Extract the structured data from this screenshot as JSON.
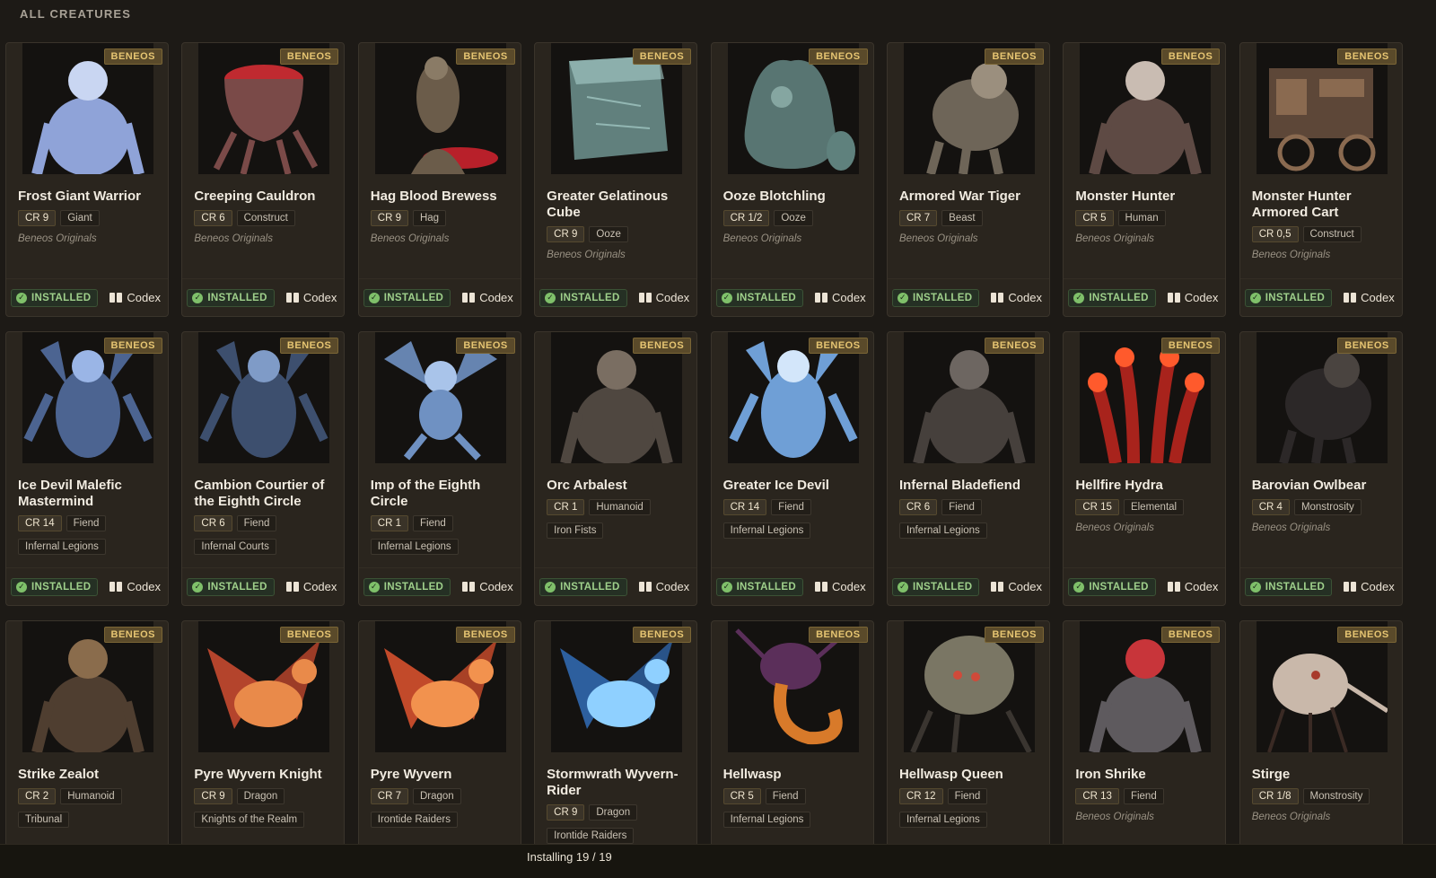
{
  "header": {
    "title": "ALL CREATURES"
  },
  "footer_labels": {
    "installed": "INSTALLED",
    "codex": "Codex"
  },
  "status": {
    "text": "Installing 19 / 19"
  },
  "creatures": [
    {
      "name": "Frost Giant Warrior",
      "badge": "BENEOS",
      "cr": "CR 9",
      "type": "Giant",
      "source": "Beneos Originals",
      "source_style": "italic",
      "art": "figure",
      "color": "#8fa3d8",
      "accent": "#c9d6f2"
    },
    {
      "name": "Creeping Cauldron",
      "badge": "BENEOS",
      "cr": "CR 6",
      "type": "Construct",
      "source": "Beneos Originals",
      "source_style": "italic",
      "art": "cauldron",
      "color": "#7a4a48",
      "accent": "#c02a30"
    },
    {
      "name": "Hag Blood Brewess",
      "badge": "BENEOS",
      "cr": "CR 9",
      "type": "Hag",
      "source": "Beneos Originals",
      "source_style": "italic",
      "art": "hag",
      "color": "#6b5c4a",
      "accent": "#b8202a"
    },
    {
      "name": "Greater Gelatinous Cube",
      "badge": "BENEOS",
      "cr": "CR 9",
      "type": "Ooze",
      "source": "Beneos Originals",
      "source_style": "italic",
      "art": "cube",
      "color": "#6e9491",
      "accent": "#a8cfcb"
    },
    {
      "name": "Ooze Blotchling",
      "badge": "BENEOS",
      "cr": "CR 1/2",
      "type": "Ooze",
      "source": "Beneos Originals",
      "source_style": "italic",
      "art": "ooze",
      "color": "#5f817d",
      "accent": "#a3c7c1"
    },
    {
      "name": "Armored War Tiger",
      "badge": "BENEOS",
      "cr": "CR 7",
      "type": "Beast",
      "source": "Beneos Originals",
      "source_style": "italic",
      "art": "beast",
      "color": "#6e6558",
      "accent": "#9b8f7e"
    },
    {
      "name": "Monster Hunter",
      "badge": "BENEOS",
      "cr": "CR 5",
      "type": "Human",
      "source": "Beneos Originals",
      "source_style": "italic",
      "art": "figure",
      "color": "#5e4a44",
      "accent": "#c9bcb2"
    },
    {
      "name": "Monster Hunter Armored Cart",
      "badge": "BENEOS",
      "cr": "CR 0,5",
      "type": "Construct",
      "source": "Beneos Originals",
      "source_style": "italic",
      "art": "cart",
      "color": "#5d4738",
      "accent": "#8a6a50"
    },
    {
      "name": "Ice Devil Malefic Mastermind",
      "badge": "BENEOS",
      "cr": "CR 14",
      "type": "Fiend",
      "source": "Infernal Legions",
      "source_style": "pill",
      "art": "devil",
      "color": "#4c6491",
      "accent": "#9ab5e6"
    },
    {
      "name": "Cambion Courtier of the Eighth Circle",
      "badge": "BENEOS",
      "cr": "CR 6",
      "type": "Fiend",
      "source": "Infernal Courts",
      "source_style": "pill",
      "art": "devil",
      "color": "#3d4f6e",
      "accent": "#7f9bc7"
    },
    {
      "name": "Imp of the Eighth Circle",
      "badge": "BENEOS",
      "cr": "CR 1",
      "type": "Fiend",
      "source": "Infernal Legions",
      "source_style": "pill",
      "art": "imp",
      "color": "#6f91c2",
      "accent": "#a9c4ea"
    },
    {
      "name": "Orc Arbalest",
      "badge": "BENEOS",
      "cr": "CR 1",
      "type": "Humanoid",
      "source": "Iron Fists",
      "source_style": "pill",
      "art": "figure",
      "color": "#4f4740",
      "accent": "#7a6e62"
    },
    {
      "name": "Greater Ice Devil",
      "badge": "BENEOS",
      "cr": "CR 14",
      "type": "Fiend",
      "source": "Infernal Legions",
      "source_style": "pill",
      "art": "devil",
      "color": "#6f9fd6",
      "accent": "#d3e6fa"
    },
    {
      "name": "Infernal Bladefiend",
      "badge": "BENEOS",
      "cr": "CR 6",
      "type": "Fiend",
      "source": "Infernal Legions",
      "source_style": "pill",
      "art": "figure",
      "color": "#46403c",
      "accent": "#6d6661"
    },
    {
      "name": "Hellfire Hydra",
      "badge": "BENEOS",
      "cr": "CR 15",
      "type": "Elemental",
      "source": "Beneos Originals",
      "source_style": "italic",
      "art": "hydra",
      "color": "#a8231c",
      "accent": "#ff5a2c"
    },
    {
      "name": "Barovian Owlbear",
      "badge": "BENEOS",
      "cr": "CR 4",
      "type": "Monstrosity",
      "source": "Beneos Originals",
      "source_style": "italic",
      "art": "beast",
      "color": "#2c2828",
      "accent": "#4a4440"
    },
    {
      "name": "Strike Zealot",
      "badge": "BENEOS",
      "cr": "CR 2",
      "type": "Humanoid",
      "source": "Tribunal",
      "source_style": "pill",
      "art": "figure",
      "color": "#4f3e30",
      "accent": "#8a6c4c"
    },
    {
      "name": "Pyre Wyvern Knight",
      "badge": "BENEOS",
      "cr": "CR 9",
      "type": "Dragon",
      "source": "Knights of the Realm",
      "source_style": "pill",
      "art": "dragon",
      "color": "#b4442c",
      "accent": "#e98a4a"
    },
    {
      "name": "Pyre Wyvern",
      "badge": "BENEOS",
      "cr": "CR 7",
      "type": "Dragon",
      "source": "Irontide Raiders",
      "source_style": "pill",
      "art": "dragon",
      "color": "#c24a2a",
      "accent": "#f2924e"
    },
    {
      "name": "Stormwrath Wyvern-Rider",
      "badge": "BENEOS",
      "cr": "CR 9",
      "type": "Dragon",
      "source": "Irontide Raiders",
      "source_style": "pill",
      "art": "dragon",
      "color": "#2d5f9e",
      "accent": "#8fd0ff"
    },
    {
      "name": "Hellwasp",
      "badge": "BENEOS",
      "cr": "CR 5",
      "type": "Fiend",
      "source": "Infernal Legions",
      "source_style": "pill",
      "art": "wasp",
      "color": "#5b2f5a",
      "accent": "#d87a2a"
    },
    {
      "name": "Hellwasp Queen",
      "badge": "BENEOS",
      "cr": "CR 12",
      "type": "Fiend",
      "source": "Infernal Legions",
      "source_style": "pill",
      "art": "queen",
      "color": "#7a7664",
      "accent": "#d04a3a"
    },
    {
      "name": "Iron Shrike",
      "badge": "BENEOS",
      "cr": "CR 13",
      "type": "Fiend",
      "source": "Beneos Originals",
      "source_style": "italic",
      "art": "figure",
      "color": "#5e5a5e",
      "accent": "#c8353a"
    },
    {
      "name": "Stirge",
      "badge": "BENEOS",
      "cr": "CR 1/8",
      "type": "Monstrosity",
      "source": "Beneos Originals",
      "source_style": "italic",
      "art": "stirge",
      "color": "#c9b8aa",
      "accent": "#a83a2c"
    }
  ]
}
